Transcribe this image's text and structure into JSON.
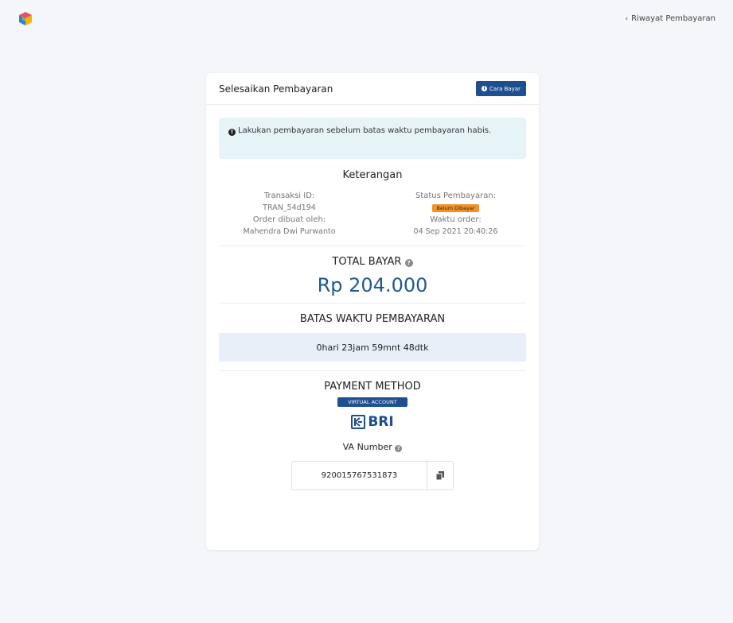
{
  "header": {
    "history_link": "Riwayat Pembayaran"
  },
  "card": {
    "title": "Selesaikan Pembayaran",
    "howto_button": "Cara Bayar",
    "alert_text": "Lakukan pembayaran sebelum batas waktu pembayaran habis.",
    "details": {
      "title": "Keterangan",
      "transaction_id_label": "Transaksi ID:",
      "transaction_id_value": "TRAN_54d194",
      "status_label": "Status Pembayaran:",
      "status_value": "Belum Dibayar",
      "created_by_label": "Order dibuat oleh:",
      "created_by_value": "Mahendra Dwi Purwanto",
      "order_time_label": "Waktu order:",
      "order_time_value": "04 Sep 2021 20:40:26"
    },
    "total": {
      "title": "TOTAL BAYAR",
      "amount": "Rp 204.000"
    },
    "deadline": {
      "title": "BATAS WAKTU PEMBAYARAN",
      "countdown": "0hari 23jam 59mnt 48dtk"
    },
    "payment": {
      "title": "PAYMENT METHOD",
      "type_badge": "VIRTUAL ACCOUNT",
      "bank": "BRI",
      "va_label": "VA Number",
      "va_number": "920015767531873"
    }
  },
  "colors": {
    "brand": "#1d4f91",
    "amount": "#1f5a8f",
    "alert_bg": "#e6f4f7",
    "deadline_bg": "#e8eff9",
    "unpaid_badge": "#f0932b"
  }
}
